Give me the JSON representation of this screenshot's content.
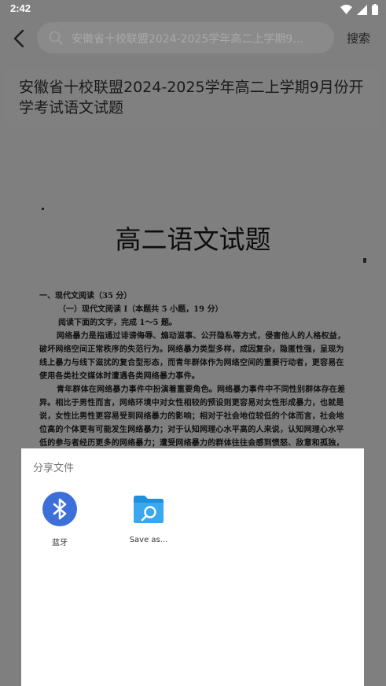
{
  "status_bar": {
    "time": "2:42",
    "icons": [
      "wifi-icon",
      "signal-icon",
      "battery-icon"
    ]
  },
  "app_bar": {
    "back_icon": "back-arrow-icon",
    "search_placeholder": "安徽省十校联盟2024-2025学年高二上学期9...",
    "search_button": "搜索"
  },
  "document": {
    "title": "安徽省十校联盟2024-2025学年高二上学期9月份开学考试语文试题",
    "preview": {
      "heading": "高二语文试题",
      "section": "一、现代文阅读（35 分）",
      "subsection": "（一）现代文阅读 I（本题共 5 小题，19 分）",
      "instruction": "阅读下面的文字，完成 1～5 题。",
      "paragraph1": "网络暴力是指通过诽谤侮辱、煽动滋事、公开隐私等方式，侵害他人的人格权益，破坏网络空间正常秩序的失范行为。网络暴力类型多样，成因复杂，隐匿性强，呈现为线上暴力与线下滋扰的复合型形态，而青年群体作为网络空间的重要行动者，更容易在使用各类社交媒体时遭遇各类网络暴力事件。",
      "paragraph2": "青年群体在网络暴力事件中扮演着重要角色。网络暴力事件中不同性别群体存在差异。相比于男性而言，网络环境中对女性相较的预设则更容易对女性形成暴力，也就是说，女性比男性更容易受到网络暴力的影响；相对于社会地位较低的个体而言，社会地位高的个体更有可能发生网络暴力；对于认知网理心水平高的人来说，认知网理心水平低的参与者经历更多的网络暴力；遭受网络暴力的群体往往会感到愤怒、敌意和孤独，这类群体处于情绪压力之下在一段时间之后可"
    }
  },
  "share_sheet": {
    "title": "分享文件",
    "targets": [
      {
        "label": "蓝牙",
        "icon": "bluetooth-icon",
        "color": "#3d6fd8"
      },
      {
        "label": "Save as...",
        "icon": "folder-search-icon",
        "color": "#2a9ee8"
      }
    ]
  },
  "colors": {
    "scrim": "#7f7f7f",
    "sheet": "#ffffff",
    "accent": "#3d6fd8"
  }
}
